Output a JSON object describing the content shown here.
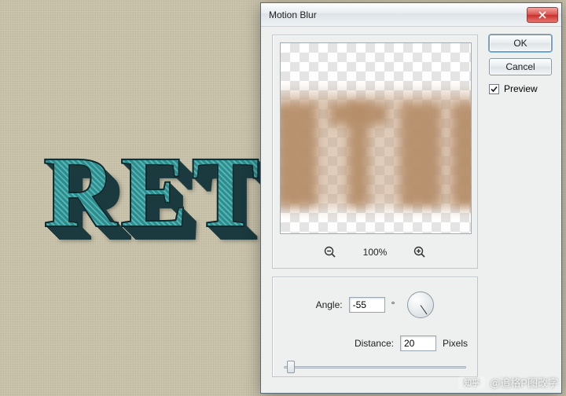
{
  "dialog": {
    "title": "Motion Blur",
    "ok_label": "OK",
    "cancel_label": "Cancel",
    "preview_label": "Preview",
    "preview_checked": true,
    "zoom_level": "100%",
    "angle": {
      "label": "Angle:",
      "value": "-55",
      "unit": "°"
    },
    "distance": {
      "label": "Distance:",
      "value": "20",
      "unit": "Pixels"
    }
  },
  "canvas_text": "RET",
  "watermark": {
    "badge": "知乎",
    "text": "@追格P图改字"
  }
}
